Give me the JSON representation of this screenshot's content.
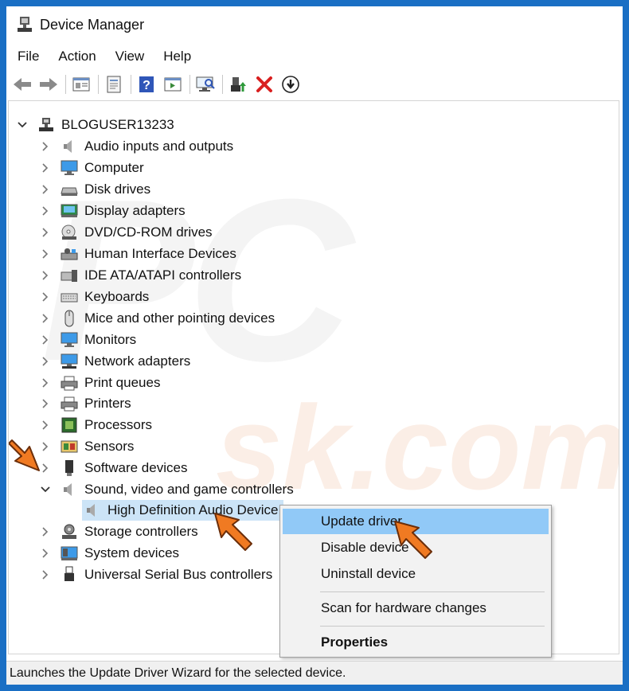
{
  "window": {
    "title": "Device Manager"
  },
  "menu": [
    "File",
    "Action",
    "View",
    "Help"
  ],
  "toolbar": {
    "buttons": [
      "back-icon",
      "forward-icon",
      "properties-pane-icon",
      "properties-icon",
      "help-icon",
      "action-pane-icon",
      "scan-hardware-icon",
      "update-driver-icon",
      "uninstall-icon",
      "download-icon"
    ]
  },
  "tree": {
    "root": "BLOGUSER13233",
    "categories": [
      "Audio inputs and outputs",
      "Computer",
      "Disk drives",
      "Display adapters",
      "DVD/CD-ROM drives",
      "Human Interface Devices",
      "IDE ATA/ATAPI controllers",
      "Keyboards",
      "Mice and other pointing devices",
      "Monitors",
      "Network adapters",
      "Print queues",
      "Printers",
      "Processors",
      "Sensors",
      "Software devices",
      "Sound, video and game controllers",
      "Storage controllers",
      "System devices",
      "Universal Serial Bus controllers"
    ],
    "expanded_child": "High Definition Audio Device"
  },
  "context_menu": {
    "update": "Update driver",
    "disable": "Disable device",
    "uninstall": "Uninstall device",
    "scan": "Scan for hardware changes",
    "properties": "Properties"
  },
  "status": "Launches the Update Driver Wizard for the selected device.",
  "colors": {
    "accent_arrow": "#f07a22",
    "selection": "#cce4f7",
    "menu_highlight": "#91c9f7"
  }
}
